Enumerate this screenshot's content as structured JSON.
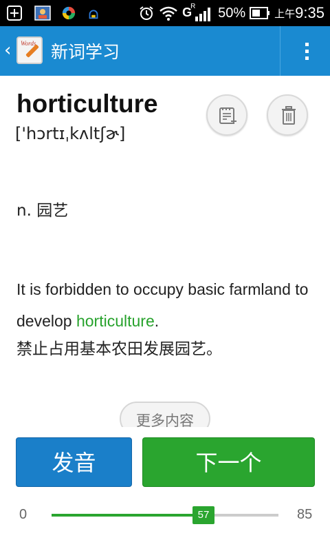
{
  "status_bar": {
    "network_label": "G",
    "network_sub": "R",
    "battery": "50%",
    "time_prefix": "上午",
    "time": "9:35"
  },
  "action_bar": {
    "title": "新词学习",
    "app_icon_text": "Words",
    "back_icon": "chevron-left-icon",
    "menu_icon": "overflow-menu-icon"
  },
  "word": {
    "headword": "horticulture",
    "phonetic": "['hɔrtɪˌkʌltʃɚ]",
    "definition": "n. 园艺",
    "example_before": "It is forbidden to occupy basic farmland to develop ",
    "example_highlight": "horticulture",
    "example_after": ".",
    "translation": "禁止占用基本农田发展园艺。",
    "add_icon": "add-to-notebook-icon",
    "delete_icon": "trash-icon"
  },
  "more_content_label": "更多内容",
  "buttons": {
    "pronounce": "发音",
    "next": "下一个"
  },
  "progress": {
    "min": "0",
    "max": "85",
    "current": "57",
    "fraction": 0.67
  },
  "colors": {
    "action_bar": "#1a8ad1",
    "accent_green": "#2aa52f",
    "pronounce_blue": "#1a7fc9"
  }
}
